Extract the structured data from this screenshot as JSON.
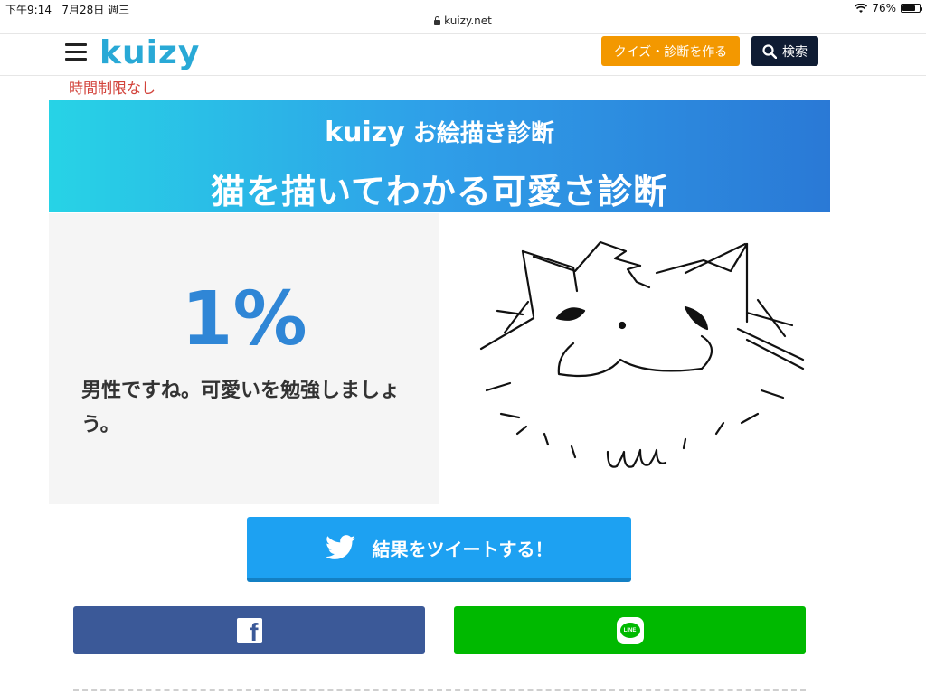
{
  "status_bar": {
    "time": "下午9:14",
    "date": "7月28日 週三",
    "battery": "76%",
    "battery_level": 0.76
  },
  "address_bar": {
    "url": "kuizy.net"
  },
  "header": {
    "logo": "kuizy",
    "create_button": "クイズ・診断を作る",
    "search_button": "検索"
  },
  "time_limit": "時間制限なし",
  "banner": {
    "subtitle_brand": "kuizy",
    "subtitle": "お絵描き診断",
    "title": "猫を描いてわかる可愛さ診断"
  },
  "result": {
    "percent": "1%",
    "message": "男性ですね。可愛いを勉強しましょう。"
  },
  "share": {
    "tweet_label": "結果をツイートする！",
    "facebook_icon": "facebook-icon",
    "line_icon": "line-icon",
    "line_text": "LINE"
  },
  "colors": {
    "brand": "#29a9d6",
    "create": "#f39800",
    "search": "#0f1c33",
    "twitter": "#1da1f2",
    "facebook": "#3b5998",
    "line": "#00b900",
    "percent": "#2f86d6",
    "time_limit": "#d2433b"
  }
}
